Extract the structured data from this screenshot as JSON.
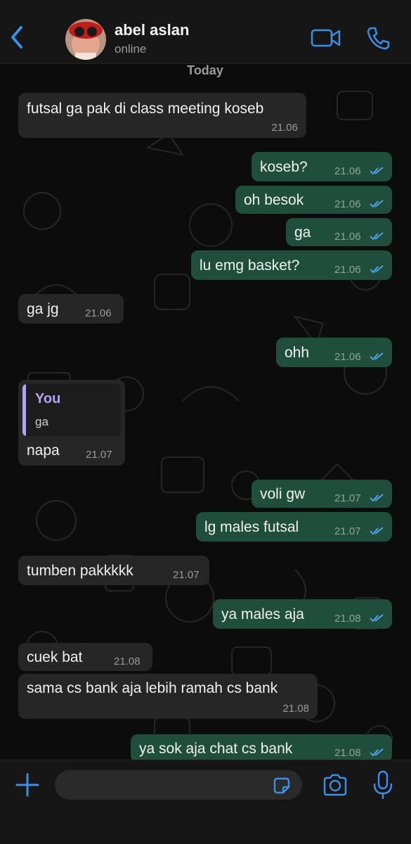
{
  "header": {
    "contact_name": "abel aslan",
    "status": "online",
    "icons": {
      "back": "chevron-left-icon",
      "video": "video-camera-icon",
      "call": "phone-icon"
    }
  },
  "date_chip": "Today",
  "messages": [
    {
      "dir": "in",
      "text": "futsal ga pak di class meeting koseb",
      "time": "21.06"
    },
    {
      "dir": "out",
      "text": "koseb?",
      "time": "21.06",
      "read": true
    },
    {
      "dir": "out",
      "text": "oh besok",
      "time": "21.06",
      "read": true
    },
    {
      "dir": "out",
      "text": "ga",
      "time": "21.06",
      "read": true
    },
    {
      "dir": "out",
      "text": "lu emg basket?",
      "time": "21.06",
      "read": true
    },
    {
      "dir": "in",
      "text": "ga jg",
      "time": "21.06"
    },
    {
      "dir": "out",
      "text": "ohh",
      "time": "21.06",
      "read": true
    },
    {
      "dir": "in",
      "text": "napa",
      "time": "21.07",
      "quote": {
        "author": "You",
        "text": "ga"
      }
    },
    {
      "dir": "out",
      "text": "voli gw",
      "time": "21.07",
      "read": true
    },
    {
      "dir": "out",
      "text": "lg males futsal",
      "time": "21.07",
      "read": true
    },
    {
      "dir": "in",
      "text": "tumben pakkkkk",
      "time": "21.07"
    },
    {
      "dir": "out",
      "text": "ya males aja",
      "time": "21.08",
      "read": true
    },
    {
      "dir": "in",
      "text": "cuek bat",
      "time": "21.08"
    },
    {
      "dir": "in",
      "text": "sama cs bank aja lebih ramah cs bank",
      "time": "21.08"
    },
    {
      "dir": "out",
      "text": "ya sok aja chat cs bank",
      "time": "21.08",
      "read": true
    }
  ],
  "composer": {
    "placeholder": "",
    "icons": {
      "attach": "plus-icon",
      "sticker": "sticker-icon",
      "camera": "camera-icon",
      "mic": "microphone-icon"
    }
  },
  "colors": {
    "accent": "#3b8fe8",
    "incoming_bubble": "#262626",
    "outgoing_bubble": "#1f4f3c",
    "read_tick": "#53a6f5",
    "quote_author": "#b3a3f0"
  }
}
